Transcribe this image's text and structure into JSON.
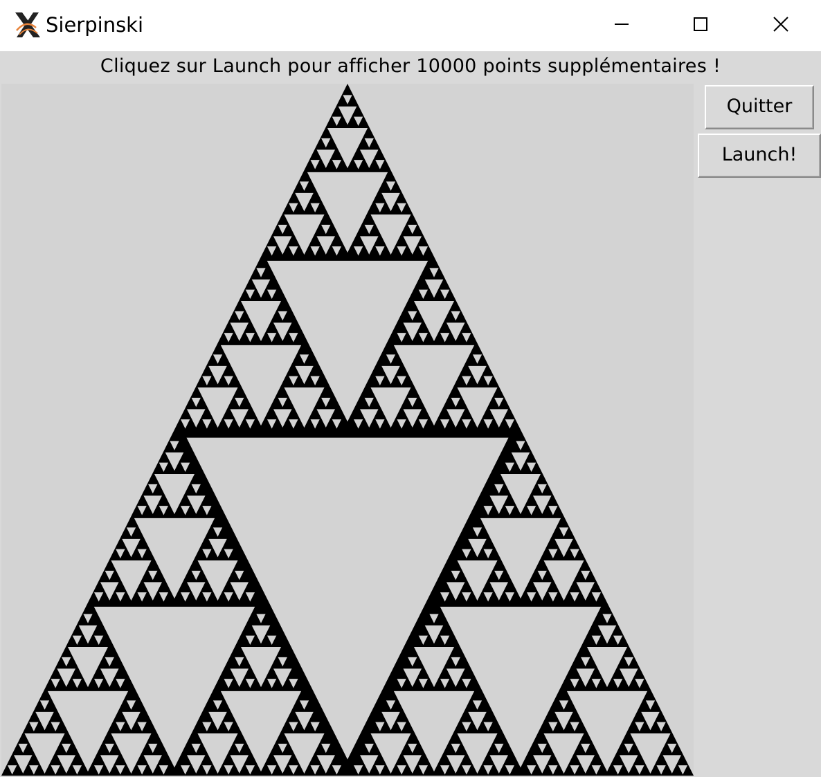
{
  "window": {
    "title": "Sierpinski",
    "icon": "x11-icon",
    "controls": {
      "minimize": "minimize-icon",
      "maximize": "maximize-icon",
      "close": "close-icon"
    }
  },
  "message": "Cliquez sur Launch pour afficher 10000 points supplémentaires !",
  "buttons": {
    "quit_label": "Quitter",
    "launch_label": "Launch!"
  },
  "canvas": {
    "background": "#d3d3d3",
    "fractal_color": "#000000",
    "fractal": "sierpinski-triangle"
  }
}
